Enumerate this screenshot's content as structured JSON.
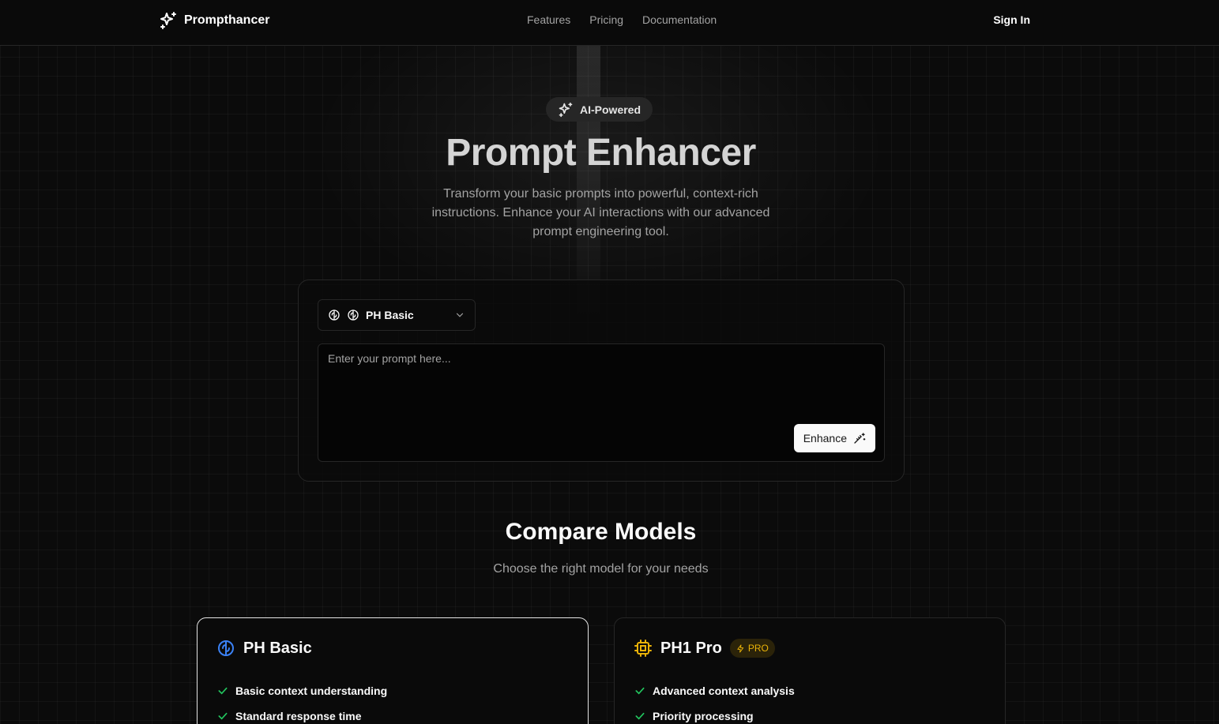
{
  "header": {
    "brand": "Prompthancer",
    "nav": [
      "Features",
      "Pricing",
      "Documentation"
    ],
    "signin": "Sign In"
  },
  "hero": {
    "badge": "AI-Powered",
    "title": "Prompt Enhancer",
    "subtitle": "Transform your basic prompts into powerful, context-rich instructions. Enhance your AI interactions with our advanced prompt engineering tool."
  },
  "enhancer": {
    "model_select": "PH Basic",
    "prompt_value": "",
    "prompt_placeholder": "Enter your prompt here...",
    "enhance_label": "Enhance"
  },
  "compare": {
    "title": "Compare Models",
    "subtitle": "Choose the right model for your needs",
    "models": [
      {
        "name": "PH Basic",
        "icon": "brain-icon",
        "icon_color": "#3b82f6",
        "badge": "",
        "features": [
          "Basic context understanding",
          "Standard response time"
        ]
      },
      {
        "name": "PH1 Pro",
        "icon": "cpu-icon",
        "icon_color": "#eab308",
        "badge": "PRO",
        "features": [
          "Advanced context analysis",
          "Priority processing"
        ]
      }
    ]
  },
  "colors": {
    "background": "#0b0b0b",
    "accent_blue": "#3b82f6",
    "accent_yellow": "#eab308",
    "check_green": "#22c55e"
  }
}
